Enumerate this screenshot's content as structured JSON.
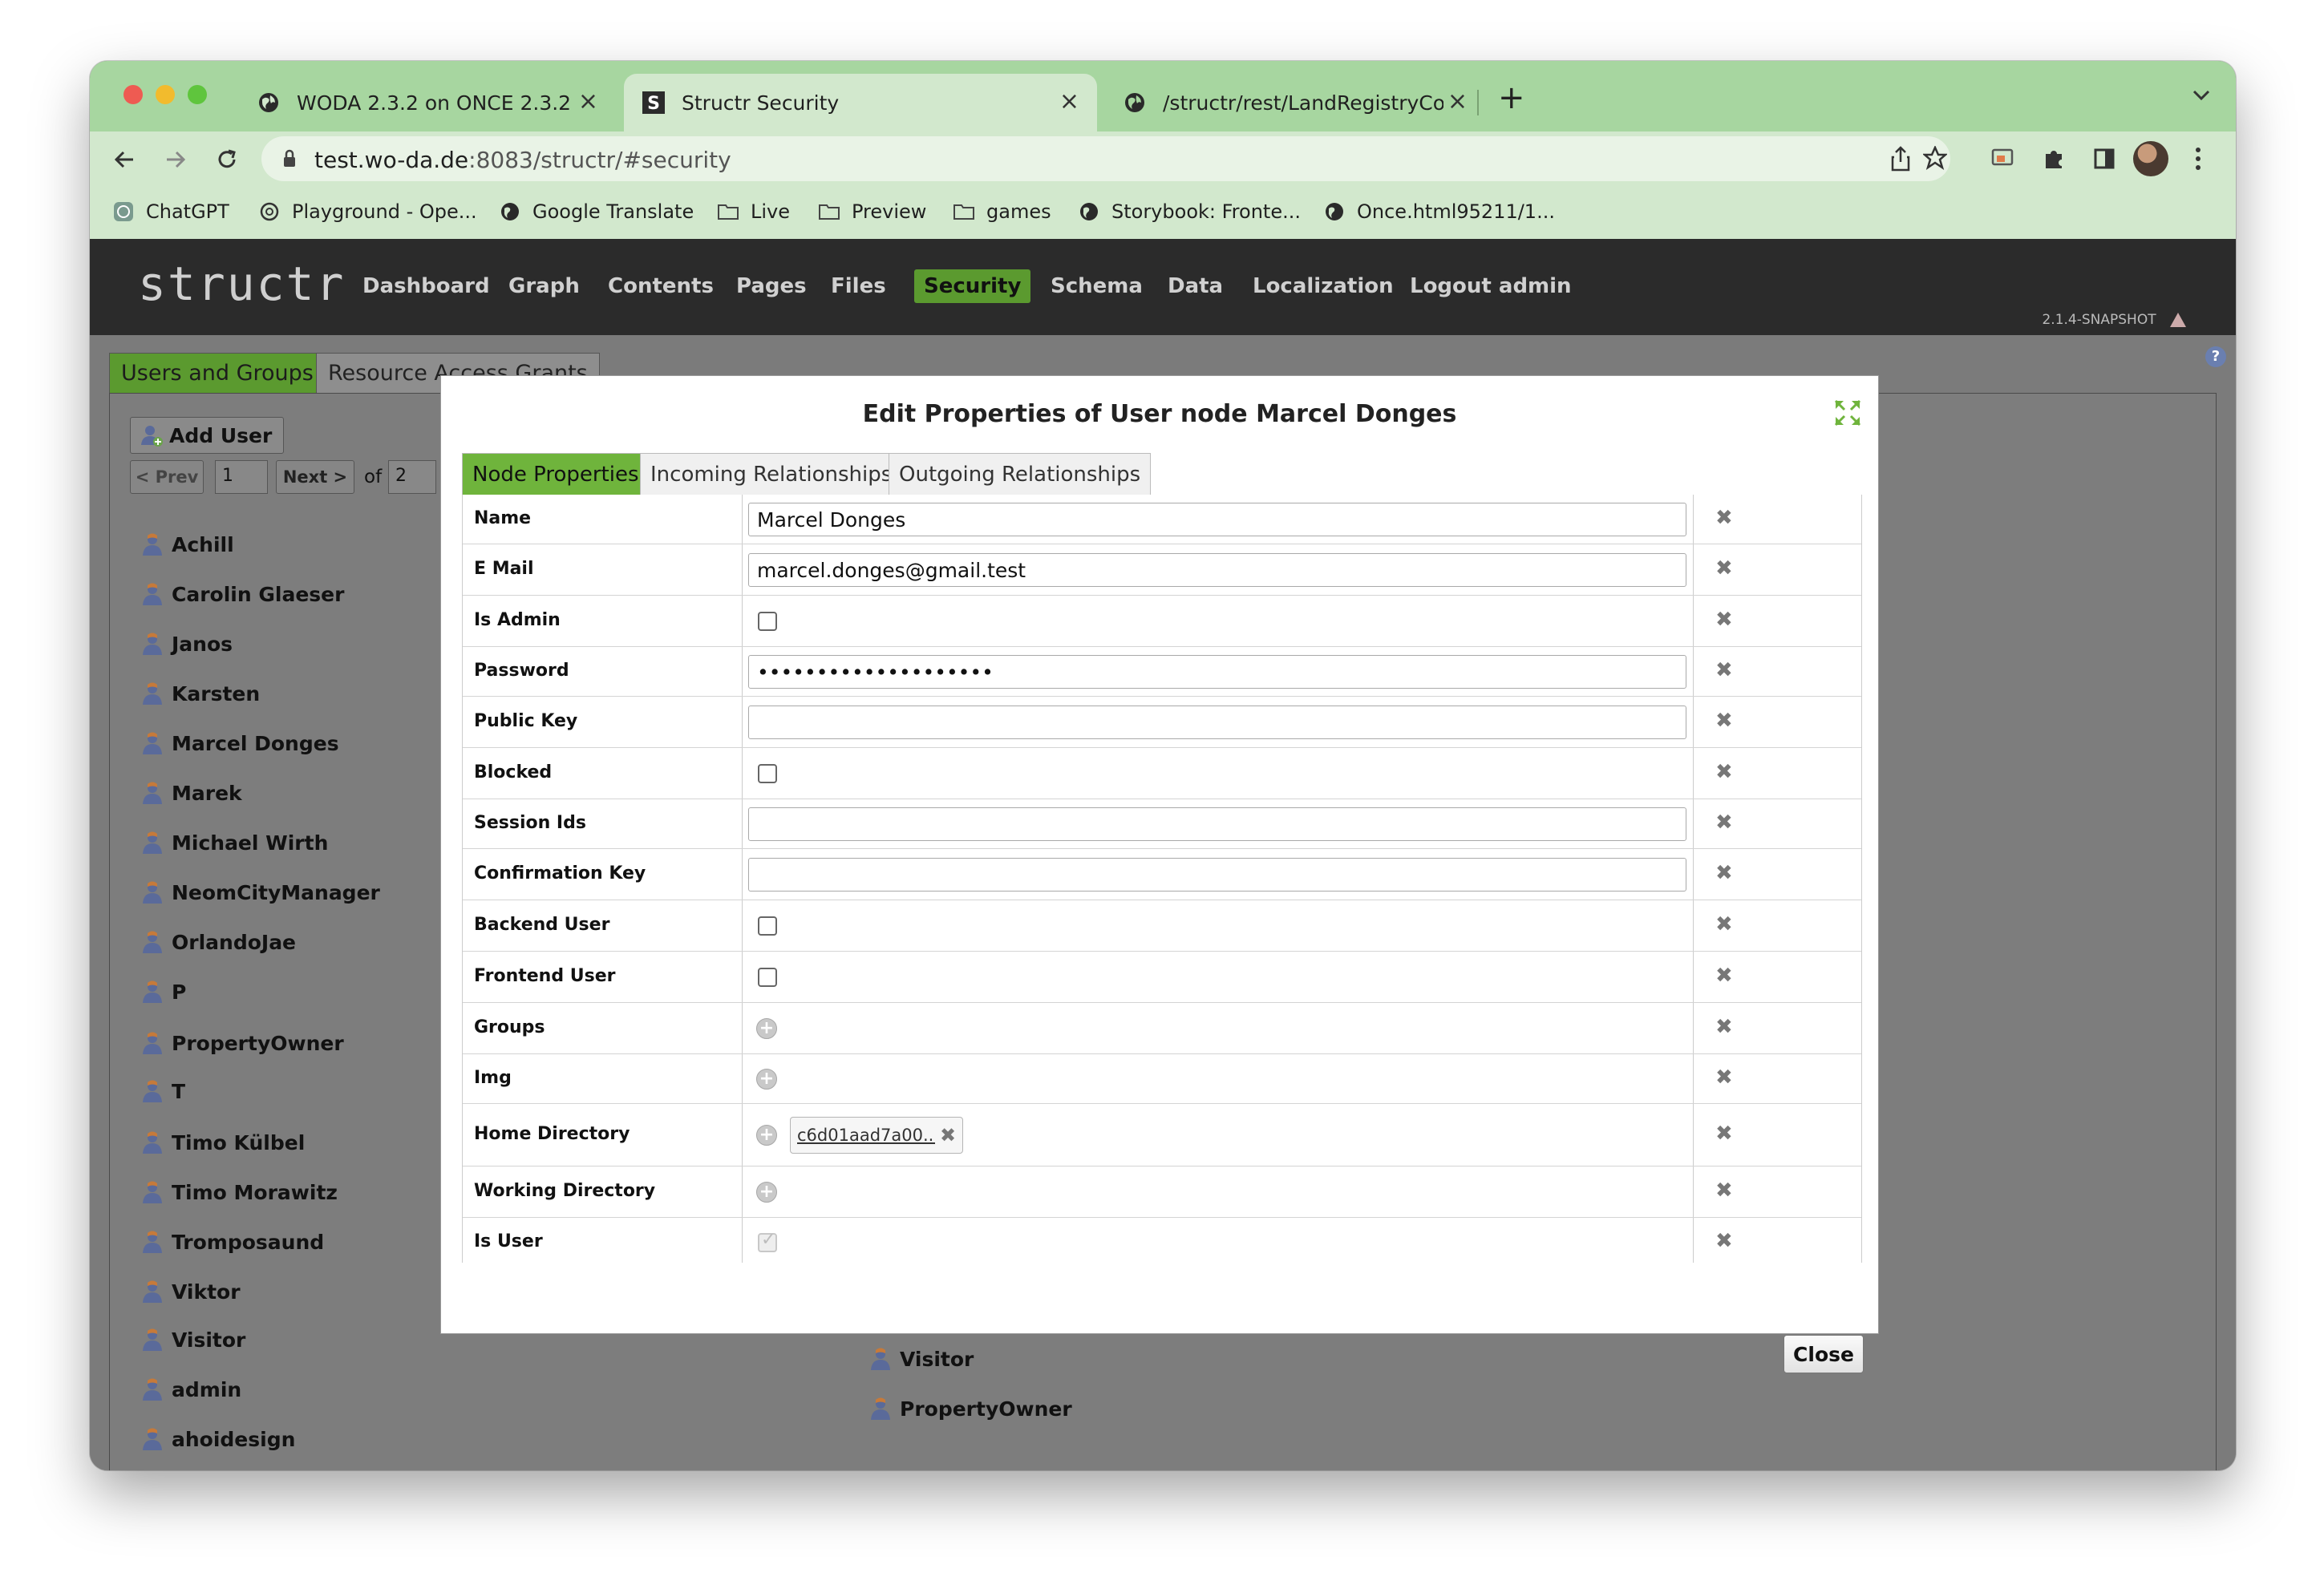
{
  "browser": {
    "tabs": [
      {
        "title": "WODA 2.3.2 on ONCE 2.3.2",
        "icon": "globe-icon"
      },
      {
        "title": "Structr Security",
        "icon": "structr-favicon"
      },
      {
        "title": "/structr/rest/LandRegistryConti",
        "icon": "globe-icon"
      }
    ],
    "url_host": "test.wo-da.de",
    "url_rest": ":8083/structr/#security",
    "bookmarks": [
      "ChatGPT",
      "Playground - Ope...",
      "Google Translate",
      "Live",
      "Preview",
      "games",
      "Storybook: Fronte...",
      "Once.html95211/1..."
    ]
  },
  "app": {
    "logo": "structr",
    "menu": [
      "Dashboard",
      "Graph",
      "Contents",
      "Pages",
      "Files",
      "Security",
      "Schema",
      "Data",
      "Localization",
      "Logout admin"
    ],
    "active_menu": "Security",
    "version": "2.1.4-SNAPSHOT",
    "help": "?",
    "page_tabs": [
      "Users and Groups",
      "Resource Access Grants"
    ],
    "add_user_label": "Add User",
    "pager": {
      "prev": "< Prev",
      "page": "1",
      "next": "Next >",
      "of": "of",
      "total": "2"
    },
    "users": [
      "Achill",
      "Carolin Glaeser",
      "Janos",
      "Karsten",
      "Marcel Donges",
      "Marek",
      "Michael Wirth",
      "NeomCityManager",
      "OrlandoJae",
      "P",
      "PropertyOwner",
      "T",
      "Timo Külbel",
      "Timo Morawitz",
      "Tromposaund",
      "Viktor",
      "Visitor",
      "admin",
      "ahoidesign"
    ],
    "group_members_visible": [
      "Visitor",
      "PropertyOwner"
    ]
  },
  "modal": {
    "title": "Edit Properties of User node Marcel Donges",
    "tabs": [
      "Node Properties",
      "Incoming Relationships",
      "Outgoing Relationships"
    ],
    "close_label": "Close",
    "properties": [
      {
        "label": "Name",
        "type": "text",
        "value": "Marcel Donges"
      },
      {
        "label": "E Mail",
        "type": "text",
        "value": "marcel.donges@gmail.test"
      },
      {
        "label": "Is Admin",
        "type": "checkbox",
        "checked": false
      },
      {
        "label": "Password",
        "type": "password",
        "value": "••••••••••••••••••••"
      },
      {
        "label": "Public Key",
        "type": "text",
        "value": ""
      },
      {
        "label": "Blocked",
        "type": "checkbox",
        "checked": false
      },
      {
        "label": "Session Ids",
        "type": "text",
        "value": ""
      },
      {
        "label": "Confirmation Key",
        "type": "text",
        "value": ""
      },
      {
        "label": "Backend User",
        "type": "checkbox",
        "checked": false
      },
      {
        "label": "Frontend User",
        "type": "checkbox",
        "checked": false
      },
      {
        "label": "Groups",
        "type": "relation"
      },
      {
        "label": "Img",
        "type": "relation"
      },
      {
        "label": "Home Directory",
        "type": "relation",
        "chip": "c6d01aad7a00..."
      },
      {
        "label": "Working Directory",
        "type": "relation"
      },
      {
        "label": "Is User",
        "type": "checkbox",
        "checked": true,
        "disabled": true
      }
    ]
  }
}
